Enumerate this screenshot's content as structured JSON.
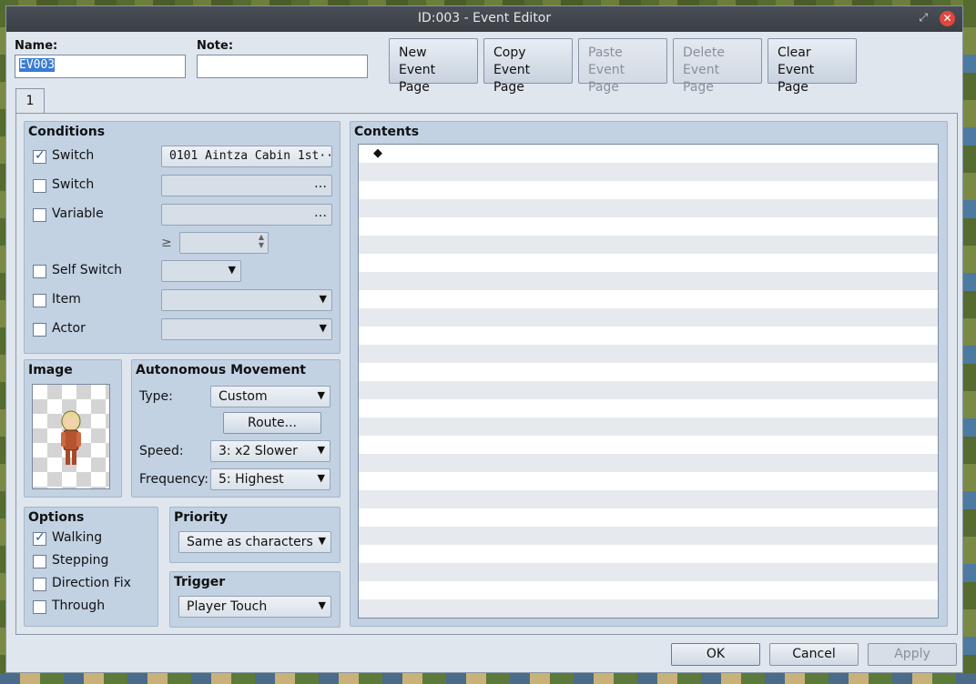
{
  "window": {
    "title": "ID:003 - Event Editor",
    "restore_glyph": "⤢",
    "close_glyph": "✕"
  },
  "header": {
    "name_label": "Name:",
    "name_value": "EV003",
    "note_label": "Note:",
    "note_value": ""
  },
  "toolbar": [
    {
      "line1": "New",
      "line2": "Event Page",
      "enabled": true
    },
    {
      "line1": "Copy",
      "line2": "Event Page",
      "enabled": true
    },
    {
      "line1": "Paste",
      "line2": "Event Page",
      "enabled": false
    },
    {
      "line1": "Delete",
      "line2": "Event Page",
      "enabled": false
    },
    {
      "line1": "Clear",
      "line2": "Event Page",
      "enabled": true
    }
  ],
  "tabs": [
    {
      "label": "1"
    }
  ],
  "conditions": {
    "title": "Conditions",
    "switch1": {
      "label": "Switch",
      "checked": true,
      "value": "0101 Aintza Cabin 1st···"
    },
    "switch2": {
      "label": "Switch",
      "checked": false,
      "value": ""
    },
    "variable": {
      "label": "Variable",
      "checked": false,
      "value": "",
      "operator": "≥",
      "number": ""
    },
    "self_switch": {
      "label": "Self Switch",
      "checked": false,
      "value": ""
    },
    "item": {
      "label": "Item",
      "checked": false,
      "value": ""
    },
    "actor": {
      "label": "Actor",
      "checked": false,
      "value": ""
    },
    "ellipsis": "…"
  },
  "image": {
    "title": "Image"
  },
  "movement": {
    "title": "Autonomous Movement",
    "type_label": "Type:",
    "type_value": "Custom",
    "route_button": "Route...",
    "speed_label": "Speed:",
    "speed_value": "3: x2 Slower",
    "frequency_label": "Frequency:",
    "frequency_value": "5: Highest"
  },
  "options": {
    "title": "Options",
    "items": [
      {
        "label": "Walking",
        "checked": true
      },
      {
        "label": "Stepping",
        "checked": false
      },
      {
        "label": "Direction Fix",
        "checked": false
      },
      {
        "label": "Through",
        "checked": false
      }
    ]
  },
  "priority": {
    "title": "Priority",
    "value": "Same as characters"
  },
  "trigger": {
    "title": "Trigger",
    "value": "Player Touch"
  },
  "contents": {
    "title": "Contents",
    "first_line": "◆"
  },
  "footer": {
    "ok": "OK",
    "cancel": "Cancel",
    "apply": "Apply"
  },
  "icons": {
    "dropdown": "▼",
    "spin_up": "▲",
    "spin_down": "▼"
  }
}
